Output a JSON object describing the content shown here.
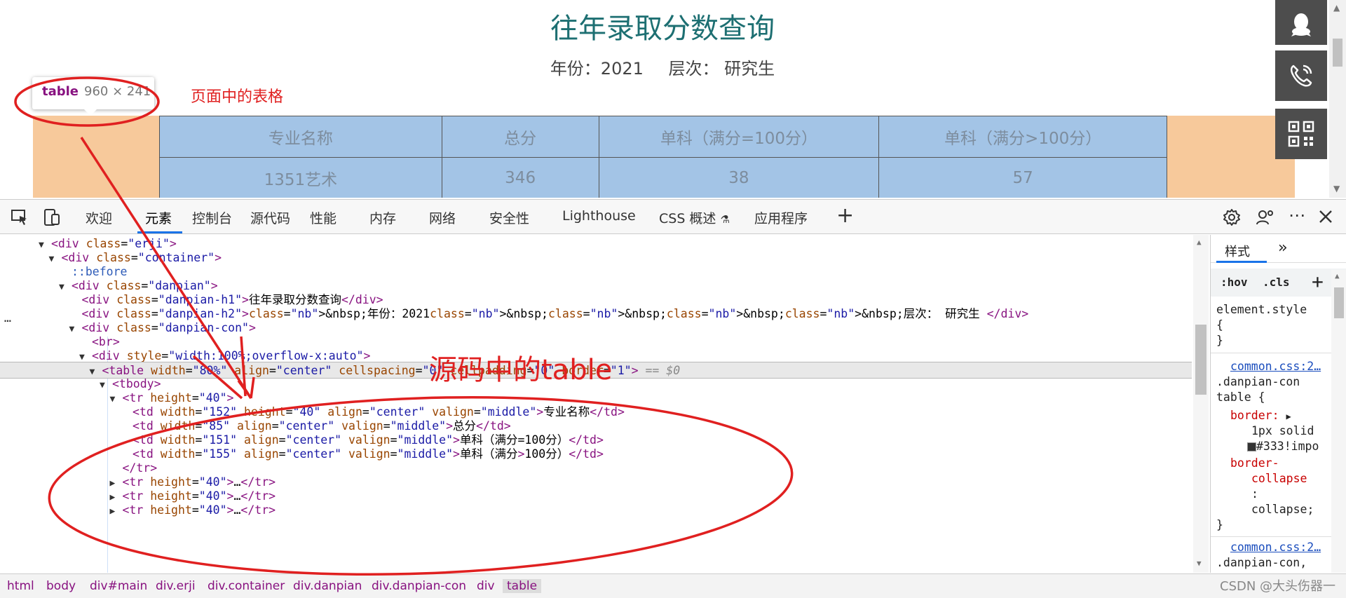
{
  "page": {
    "title": "往年录取分数查询",
    "year_label": "年份：2021",
    "level_label": "层次： 研究生",
    "table": {
      "headers": [
        "专业名称",
        "总分",
        "单科（满分=100分）",
        "单科（满分>100分）"
      ],
      "rows": [
        [
          "1351艺术",
          "346",
          "38",
          "57"
        ]
      ]
    },
    "tooltip": {
      "tag": "table",
      "size": "960 × 241"
    },
    "annotation_page_table": "页面中的表格"
  },
  "devtools": {
    "tabs": [
      "欢迎",
      "元素",
      "控制台",
      "源代码",
      "性能",
      "内存",
      "网络",
      "安全性",
      "Lighthouse",
      "CSS 概述",
      "应用程序"
    ],
    "active_tab": "元素",
    "annotation_source_table": "源码中的table",
    "elements": [
      {
        "indent": 0,
        "t": "▼",
        "h": "<div class=\"erji\">"
      },
      {
        "indent": 1,
        "t": "▼",
        "h": "<div class=\"container\">"
      },
      {
        "indent": 2,
        "t": "",
        "h": "::before"
      },
      {
        "indent": 2,
        "t": "▼",
        "h": "<div class=\"danpian\">"
      },
      {
        "indent": 3,
        "t": "",
        "h": "<div class=\"danpian-h1\">往年录取分数查询</div>"
      },
      {
        "indent": 3,
        "t": "",
        "h": "<div class=\"danpian-h2\">&nbsp;年份：2021&nbsp;&nbsp;&nbsp;&nbsp;层次： 研究生 </div>"
      },
      {
        "indent": 3,
        "t": "▼",
        "h": "<div class=\"danpian-con\">"
      },
      {
        "indent": 4,
        "t": "",
        "h": "<br>"
      },
      {
        "indent": 4,
        "t": "▼",
        "h": "<div style=\"width:100%;overflow-x:auto\">"
      },
      {
        "indent": 5,
        "t": "▼",
        "h": "<table width=\"80%\" align=\"center\" cellspacing=\"0\" cellpadding=\"0\" border=\"1\">",
        "sel": true,
        "suffix": " == $0"
      },
      {
        "indent": 6,
        "t": "▼",
        "h": "<tbody>"
      },
      {
        "indent": 7,
        "t": "▼",
        "h": "<tr height=\"40\">"
      },
      {
        "indent": 8,
        "t": "",
        "h": "<td width=\"152\" height=\"40\" align=\"center\" valign=\"middle\">专业名称</td>"
      },
      {
        "indent": 8,
        "t": "",
        "h": "<td width=\"85\" align=\"center\" valign=\"middle\">总分</td>"
      },
      {
        "indent": 8,
        "t": "",
        "h": "<td width=\"151\" align=\"center\" valign=\"middle\">单科（满分=100分）</td>"
      },
      {
        "indent": 8,
        "t": "",
        "h": "<td width=\"155\" align=\"center\" valign=\"middle\">单科（满分>100分）</td>"
      },
      {
        "indent": 7,
        "t": "",
        "h": "</tr>"
      },
      {
        "indent": 7,
        "t": "▶",
        "h": "<tr height=\"40\">…</tr>"
      },
      {
        "indent": 7,
        "t": "▶",
        "h": "<tr height=\"40\">…</tr>"
      },
      {
        "indent": 7,
        "t": "▶",
        "h": "<tr height=\"40\">…</tr>"
      }
    ],
    "styles": {
      "tab": "样式",
      "hov": ":hov",
      "cls": ".cls",
      "element_style": "element.style",
      "open_brace": "{",
      "close_brace": "}",
      "rule1_link": "common.css:2…",
      "rule1_sel1": ".danpian-con",
      "rule1_sel2": "table {",
      "prop_border": "border:",
      "val_border1": "1px solid",
      "val_border2": "#333!impo",
      "prop_collapse1": "border-",
      "prop_collapse2": "collapse",
      "colon": ":",
      "val_collapse": "collapse;",
      "rule2_link": "common.css:2…",
      "rule2_sel1": ".danpian-con,",
      "rule2_sel2": ".danpian-con *"
    },
    "breadcrumbs": [
      "html",
      "body",
      "div#main",
      "div.erji",
      "div.container",
      "div.danpian",
      "div.danpian-con",
      "div",
      "table"
    ],
    "watermark": "CSDN @大头伤器一"
  }
}
